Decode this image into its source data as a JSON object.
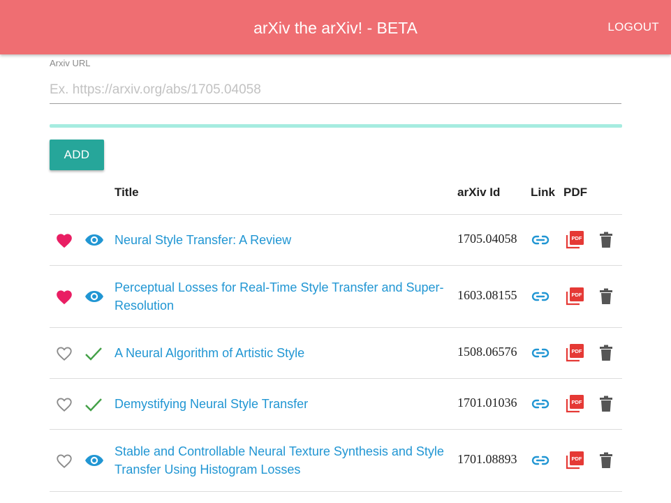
{
  "header": {
    "title": "arXiv the arXiv! - BETA",
    "logout_label": "LOGOUT",
    "color": "#ef6e72"
  },
  "form": {
    "url_label": "Arxiv URL",
    "url_placeholder": "Ex. https://arxiv.org/abs/1705.04058",
    "url_value": "",
    "add_label": "ADD",
    "add_color": "#26a69a",
    "progress_color": "#a6ece0"
  },
  "table": {
    "columns": {
      "title": "Title",
      "arxiv_id": "arXiv Id",
      "link": "Link",
      "pdf": "PDF"
    },
    "rows": [
      {
        "title": "Neural Style Transfer: A Review",
        "arxiv_id": "1705.04058",
        "favorite": true,
        "status": "reading"
      },
      {
        "title": "Perceptual Losses for Real-Time Style Transfer and Super-Resolution",
        "arxiv_id": "1603.08155",
        "favorite": true,
        "status": "reading"
      },
      {
        "title": "A Neural Algorithm of Artistic Style",
        "arxiv_id": "1508.06576",
        "favorite": false,
        "status": "done"
      },
      {
        "title": "Demystifying Neural Style Transfer",
        "arxiv_id": "1701.01036",
        "favorite": false,
        "status": "done"
      },
      {
        "title": "Stable and Controllable Neural Texture Synthesis and Style Transfer Using Histogram Losses",
        "arxiv_id": "1701.08893",
        "favorite": false,
        "status": "reading"
      }
    ]
  },
  "icons": {
    "favorite_on": "heart-filled-icon",
    "favorite_off": "heart-outline-icon",
    "reading": "eye-icon",
    "done": "check-icon",
    "link": "link-icon",
    "pdf": "pdf-icon",
    "delete": "trash-icon"
  },
  "colors": {
    "heart": "#e91e63",
    "heart_outline": "#8a8a8a",
    "eye": "#2196d3",
    "check": "#43a047",
    "link": "#2196d3",
    "pdf": "#e53935",
    "trash": "#555555",
    "title_link": "#2196d3"
  }
}
